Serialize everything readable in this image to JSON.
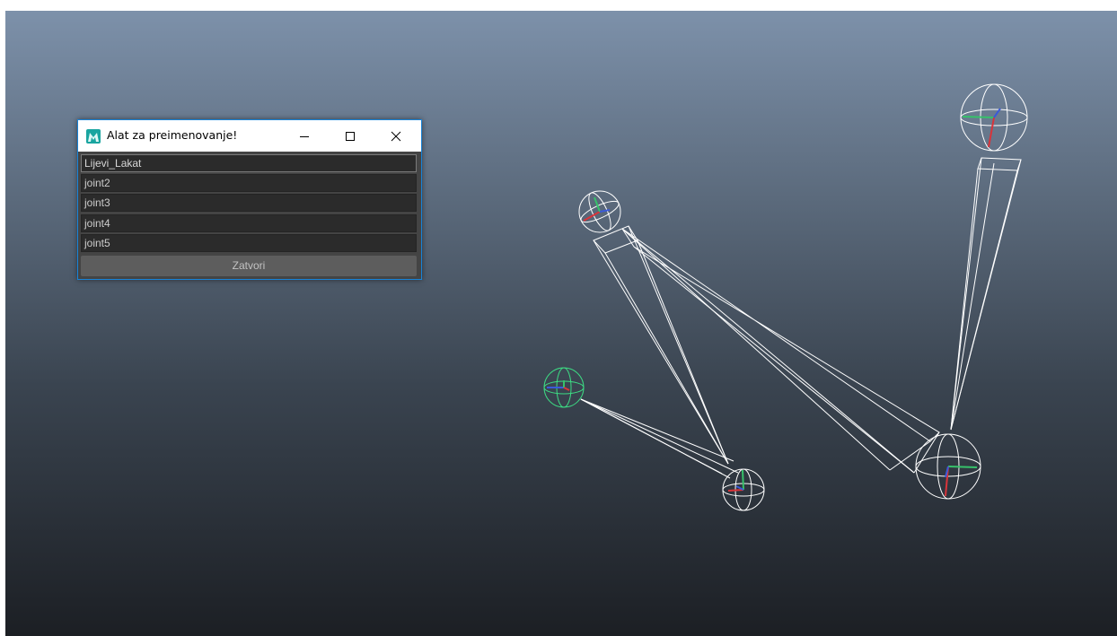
{
  "window": {
    "title": "Alat za preimenovanje!",
    "icon": "maya-app-icon",
    "fields": [
      {
        "value": "Lijevi_Lakat"
      },
      {
        "value": "joint2"
      },
      {
        "value": "joint3"
      },
      {
        "value": "joint4"
      },
      {
        "value": "joint5"
      }
    ],
    "close_label": "Zatvori",
    "accent_color": "#1883d7"
  },
  "viewport": {
    "background_top": "#7d91aa",
    "background_bottom": "#1c1f24",
    "wireframe_color": "#ffffff",
    "selected_color": "#3ddc84",
    "joints": [
      "joint-root",
      "joint-shoulder",
      "joint-elbow",
      "joint-wrist",
      "joint-end"
    ]
  }
}
